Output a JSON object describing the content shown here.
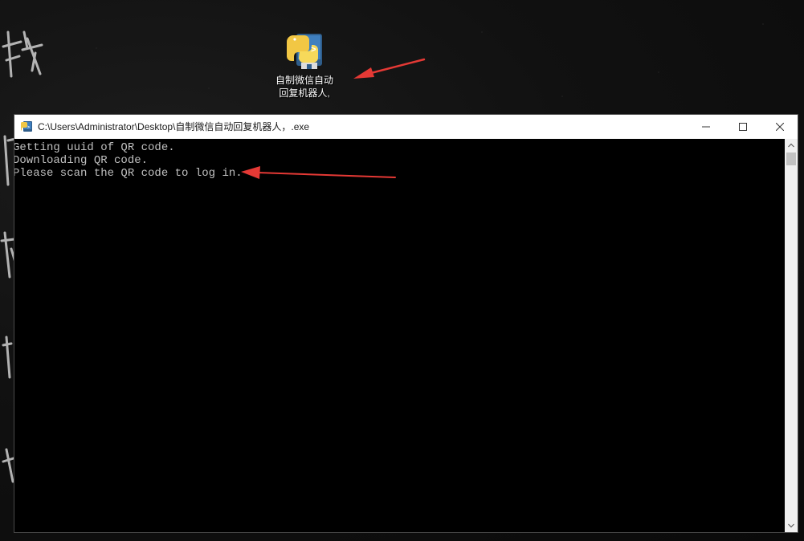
{
  "desktop": {
    "shortcut": {
      "label": "自制微信自动\n回复机器人,",
      "icon": "python-file-icon"
    }
  },
  "window": {
    "title": "C:\\Users\\Administrator\\Desktop\\自制微信自动回复机器人，.exe",
    "icon": "python-console-icon",
    "controls": {
      "minimize": "minimize-icon",
      "maximize": "maximize-icon",
      "close": "close-icon"
    }
  },
  "console": {
    "lines": [
      "Getting uuid of QR code.",
      "Downloading QR code.",
      "Please scan the QR code to log in."
    ],
    "text_color": "#c0c0c0",
    "background": "#000000"
  },
  "annotations": {
    "arrow_color": "#e53935"
  }
}
